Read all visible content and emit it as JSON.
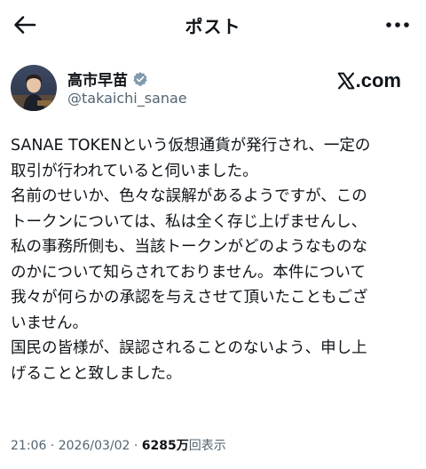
{
  "header": {
    "title": "ポスト"
  },
  "author": {
    "name": "高市早苗",
    "handle": "@takaichi_sanae",
    "verified_icon": "verified-badge-icon",
    "avatar_icon": "profile-photo"
  },
  "source_badge": {
    "text": ".com",
    "icon": "x-logo-icon"
  },
  "post": {
    "lines": [
      "SANAE TOKENという仮想通貨が発行され、一定の",
      "取引が行われていると伺いました。",
      "名前のせいか、色々な誤解があるようですが、この",
      "トークンについては、私は全く存じ上げませんし、",
      "私の事務所側も、当該トークンがどのようなものな",
      "のかについて知らされておりません。本件について",
      "我々が何らかの承認を与えさせて頂いたこともござ",
      "いません。",
      "国民の皆様が、誤認されることのないよう、申し上",
      "げることと致しました。"
    ]
  },
  "meta": {
    "time": "21:06",
    "separator1": " · ",
    "date": "2026/03/02",
    "separator2": " · ",
    "views_count": "6285万",
    "views_label": "回表示"
  },
  "colors": {
    "text": "#0f1419",
    "secondary": "#536471",
    "verified": "#829aab"
  }
}
